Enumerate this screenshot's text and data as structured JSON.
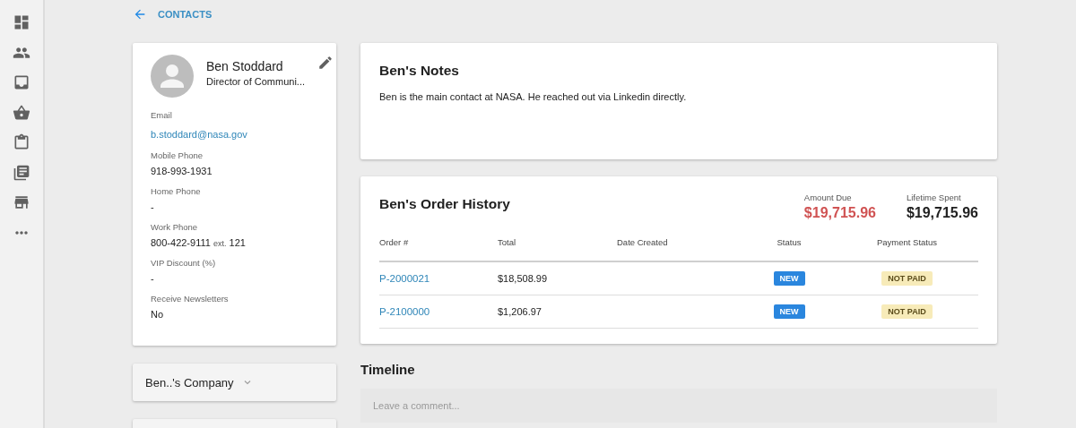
{
  "back_link": {
    "label": "CONTACTS"
  },
  "contact": {
    "name": "Ben Stoddard",
    "title": "Director of Communi...",
    "fields": [
      {
        "label": "Email",
        "value": "b.stoddard@nasa.gov",
        "kind": "link"
      },
      {
        "label": "Mobile Phone",
        "value": "918-993-1931",
        "kind": "text"
      },
      {
        "label": "Home Phone",
        "value": "-",
        "kind": "text"
      },
      {
        "label": "Work Phone",
        "value": "800-422-9111",
        "extension_label": "ext.",
        "extension": "121",
        "kind": "phone"
      },
      {
        "label": "VIP Discount (%)",
        "value": "-",
        "kind": "text"
      },
      {
        "label": "Receive Newsletters",
        "value": "No",
        "kind": "text"
      }
    ]
  },
  "company_panel": {
    "label": "Ben..'s Company",
    "expanded": false
  },
  "notes": {
    "title": "Ben's Notes",
    "text": "Ben is the main contact at NASA. He reached out via Linkedin directly."
  },
  "order_history": {
    "title": "Ben's Order History",
    "summary": [
      {
        "label": "Amount Due",
        "value": "$19,715.96",
        "kind": "due"
      },
      {
        "label": "Lifetime Spent",
        "value": "$19,715.96",
        "kind": "total"
      }
    ],
    "columns": [
      "Order #",
      "Total",
      "Date Created",
      "Status",
      "Payment Status"
    ],
    "rows": [
      {
        "order": "P-2000021",
        "total": "$18,508.99",
        "status": "NEW",
        "payment_status": "NOT PAID"
      },
      {
        "order": "P-2100000",
        "total": "$1,206.97",
        "status": "NEW",
        "payment_status": "NOT PAID"
      }
    ]
  },
  "timeline": {
    "title": "Timeline",
    "placeholder": "Leave a comment..."
  }
}
